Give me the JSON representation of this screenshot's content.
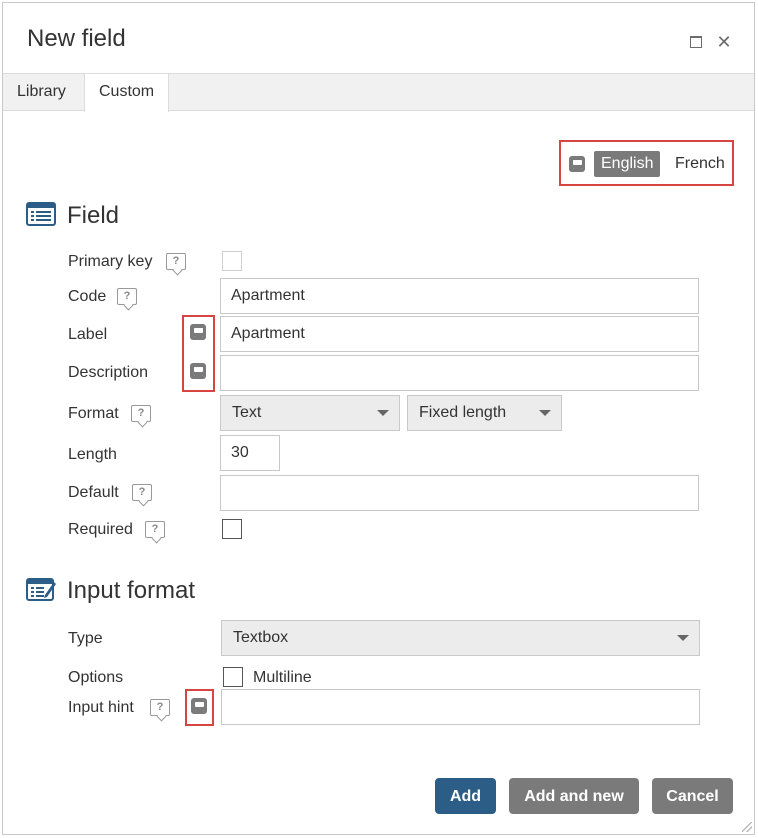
{
  "dialog": {
    "title": "New field",
    "maximize_icon": "maximize-icon",
    "close_icon": "close-icon",
    "close_glyph": "✕"
  },
  "tabs": [
    {
      "label": "Library",
      "active": false
    },
    {
      "label": "Custom",
      "active": true
    }
  ],
  "languages": {
    "icon": "translate-icon",
    "items": [
      {
        "label": "English",
        "selected": true
      },
      {
        "label": "French",
        "selected": false
      }
    ]
  },
  "field_section": {
    "title": "Field",
    "icon": "list-icon",
    "primary_key": {
      "label": "Primary key",
      "help": "?",
      "checked": false,
      "disabled": true
    },
    "code": {
      "label": "Code",
      "help": "?",
      "value": "Apartment"
    },
    "label_field": {
      "label": "Label",
      "value": "Apartment",
      "icon": "translate-icon"
    },
    "description": {
      "label": "Description",
      "value": "",
      "icon": "translate-icon"
    },
    "format": {
      "label": "Format",
      "help": "?",
      "type_value": "Text",
      "length_mode_value": "Fixed length"
    },
    "length": {
      "label": "Length",
      "value": "30"
    },
    "default": {
      "label": "Default",
      "help": "?",
      "value": ""
    },
    "required": {
      "label": "Required",
      "help": "?",
      "checked": false
    }
  },
  "input_section": {
    "title": "Input format",
    "icon": "edit-form-icon",
    "type": {
      "label": "Type",
      "value": "Textbox"
    },
    "options": {
      "label": "Options",
      "multiline_label": "Multiline",
      "multiline_checked": false
    },
    "input_hint": {
      "label": "Input hint",
      "help": "?",
      "value": "",
      "icon": "translate-icon"
    }
  },
  "buttons": {
    "add": "Add",
    "add_and_new": "Add and new",
    "cancel": "Cancel"
  },
  "colors": {
    "accent_primary": "#2c5d86",
    "button_secondary": "#7a7a7a",
    "highlight_border": "#d64541"
  }
}
